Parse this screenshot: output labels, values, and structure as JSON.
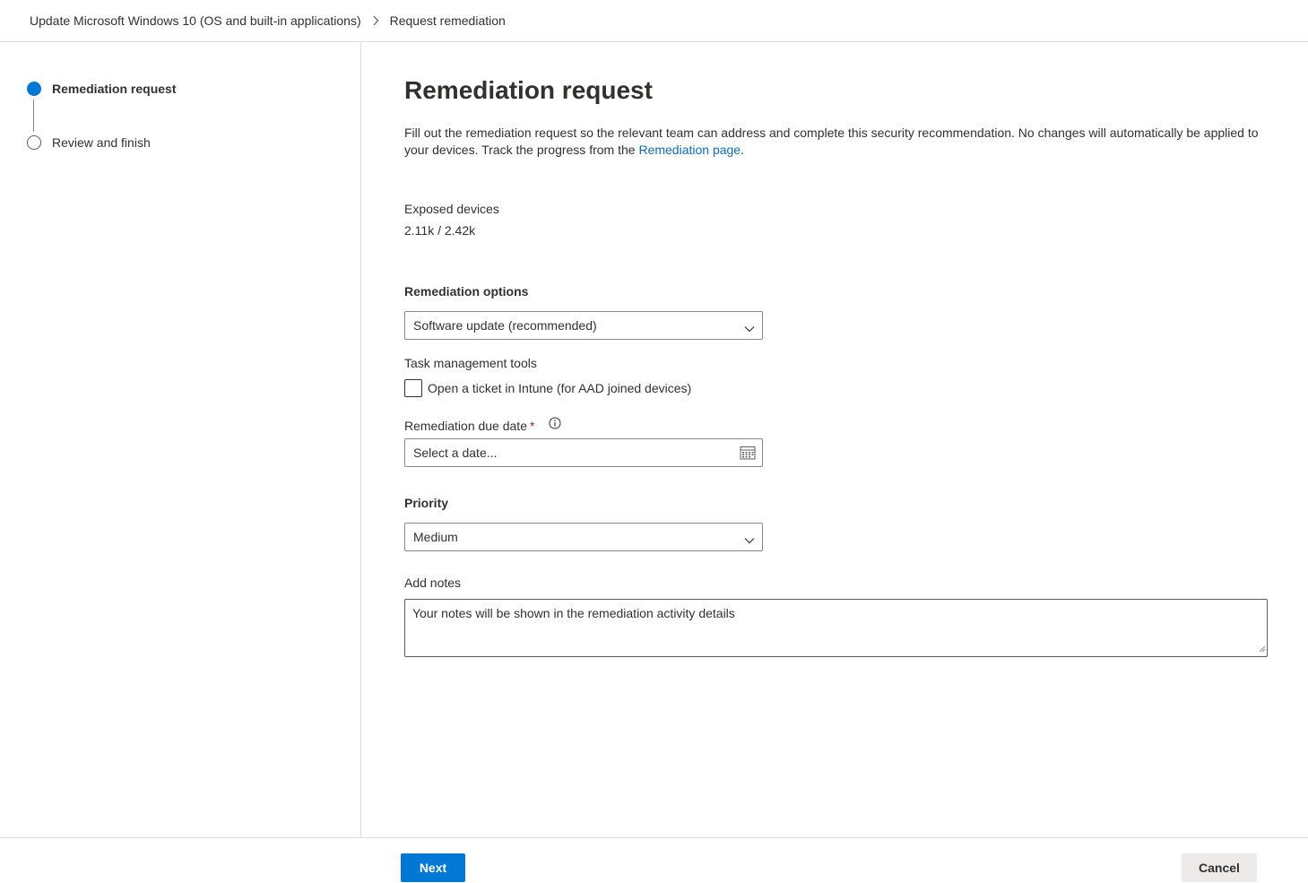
{
  "breadcrumb": {
    "parent": "Update Microsoft Windows 10 (OS and built-in applications)",
    "current": "Request remediation"
  },
  "wizard": {
    "steps": [
      {
        "label": "Remediation request",
        "state": "active"
      },
      {
        "label": "Review and finish",
        "state": "pending"
      }
    ]
  },
  "main": {
    "title": "Remediation request",
    "description_prefix": "Fill out the remediation request so the relevant team can address and complete this security recommendation. No changes will automatically be applied to your devices. Track the progress from the ",
    "description_link": "Remediation page",
    "description_suffix": ".",
    "exposed_devices_label": "Exposed devices",
    "exposed_devices_value": "2.11k / 2.42k",
    "remediation_options_label": "Remediation options",
    "remediation_options_value": "Software update (recommended)",
    "task_tools_label": "Task management tools",
    "intune_checkbox_label": "Open a ticket in Intune (for AAD joined devices)",
    "intune_checked": false,
    "due_date_label": "Remediation due date",
    "due_date_required_mark": "*",
    "due_date_placeholder": "Select a date...",
    "priority_label": "Priority",
    "priority_value": "Medium",
    "notes_label": "Add notes",
    "notes_placeholder": "Your notes will be shown in the remediation activity details"
  },
  "footer": {
    "next_label": "Next",
    "cancel_label": "Cancel"
  },
  "icons": {
    "breadcrumb_separator": "chevron-right-icon",
    "dropdown_caret": "chevron-down-icon",
    "info": "info-icon",
    "calendar": "calendar-icon"
  },
  "colors": {
    "accent": "#0078d4",
    "link": "#0f6cbd",
    "required": "#a4262c",
    "border": "#e1dfdd",
    "secondary_button": "#edebe9"
  }
}
